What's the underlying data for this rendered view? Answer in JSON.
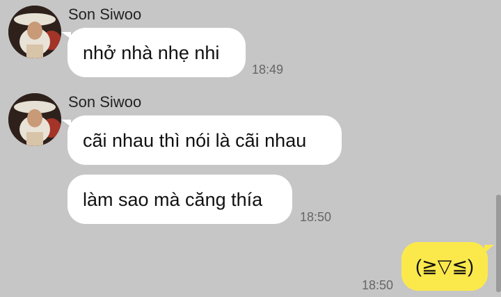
{
  "messages": [
    {
      "sender": "Son Siwoo",
      "bubbles": [
        "nhở nhà nhẹ nhi"
      ],
      "time": "18:49"
    },
    {
      "sender": "Son Siwoo",
      "bubbles": [
        "cãi nhau thì nói là cãi nhau",
        "làm sao mà căng thía"
      ],
      "time": "18:50"
    }
  ],
  "my_message": {
    "text": "(≧▽≦)",
    "time": "18:50"
  },
  "colors": {
    "background": "#c6c6c6",
    "incoming_bubble": "#ffffff",
    "outgoing_bubble": "#fbe94c"
  }
}
